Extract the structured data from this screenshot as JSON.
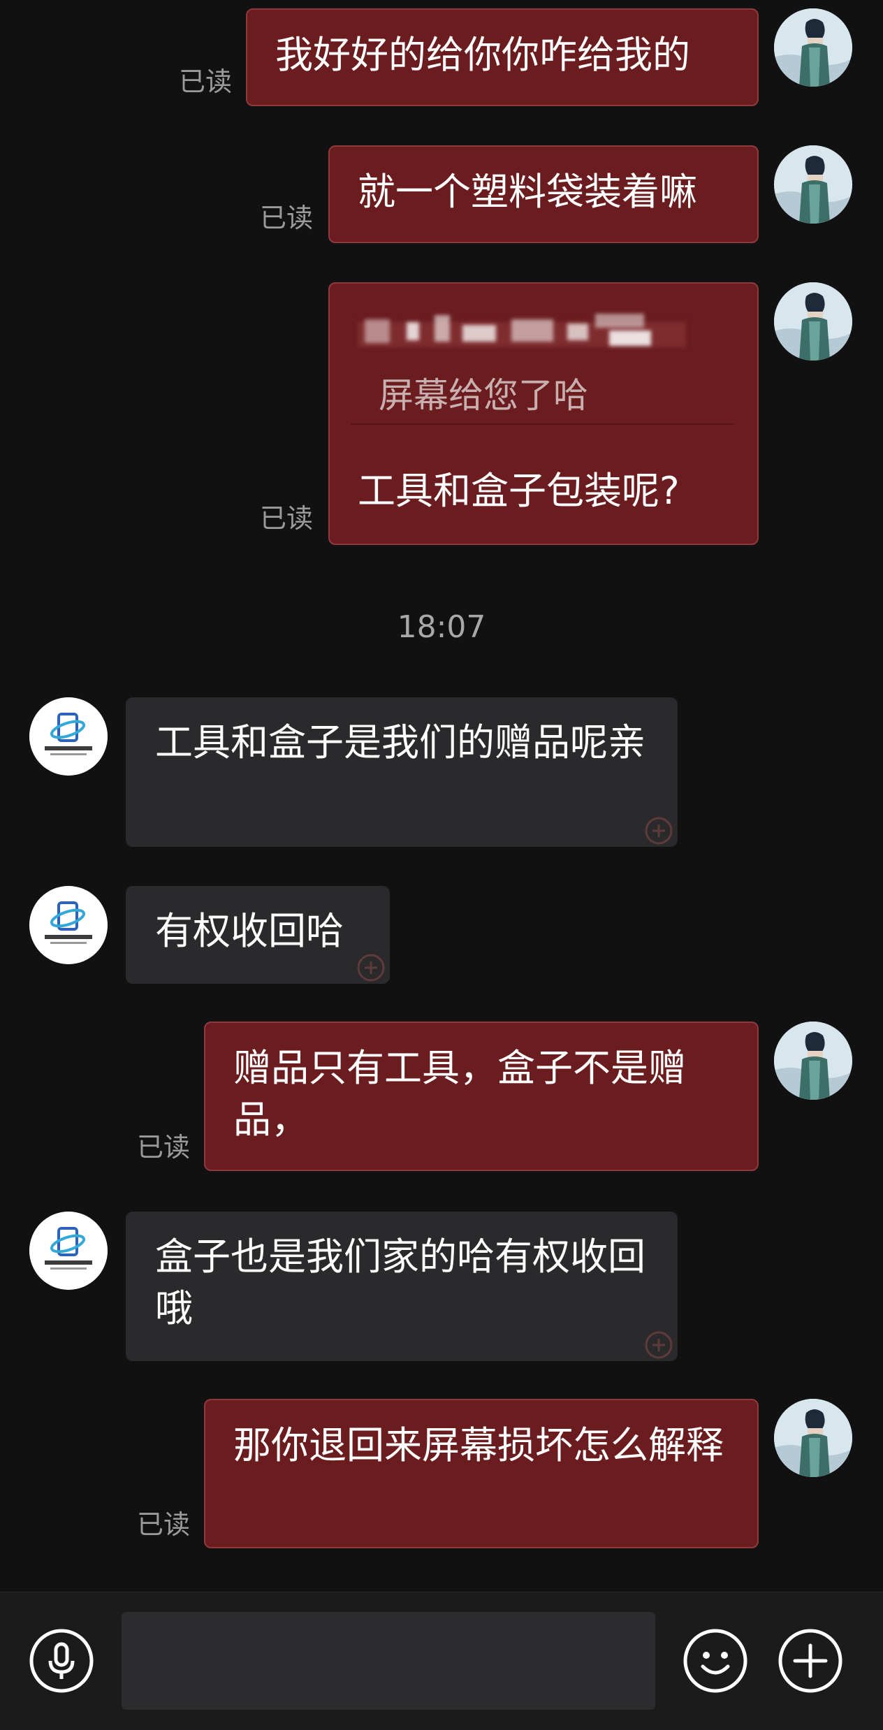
{
  "read_label": "已读",
  "timestamp": "18:07",
  "messages": [
    {
      "side": "out",
      "text": "我好好的给你你咋给我的"
    },
    {
      "side": "out",
      "text": "就一个塑料袋装着嘛"
    },
    {
      "side": "out",
      "quote_text": "屏幕给您了哈",
      "text": "工具和盒子包装呢?"
    },
    {
      "side": "in",
      "text": "工具和盒子是我们的赠品呢亲"
    },
    {
      "side": "in",
      "text": "有权收回哈"
    },
    {
      "side": "out",
      "text": "赠品只有工具，盒子不是赠品，"
    },
    {
      "side": "in",
      "text": "盒子也是我们家的哈有权收回哦"
    },
    {
      "side": "out",
      "text": "那你退回来屏幕损坏怎么解释"
    }
  ],
  "input": {
    "value": ""
  },
  "icons": {
    "voice": "microphone-icon",
    "emoji": "emoji-icon",
    "more": "plus-icon"
  },
  "colors": {
    "background": "#111111",
    "outgoing_bubble": "#6a1c1e",
    "incoming_bubble": "#2a2a2c",
    "read_text": "#9a9a9a"
  }
}
